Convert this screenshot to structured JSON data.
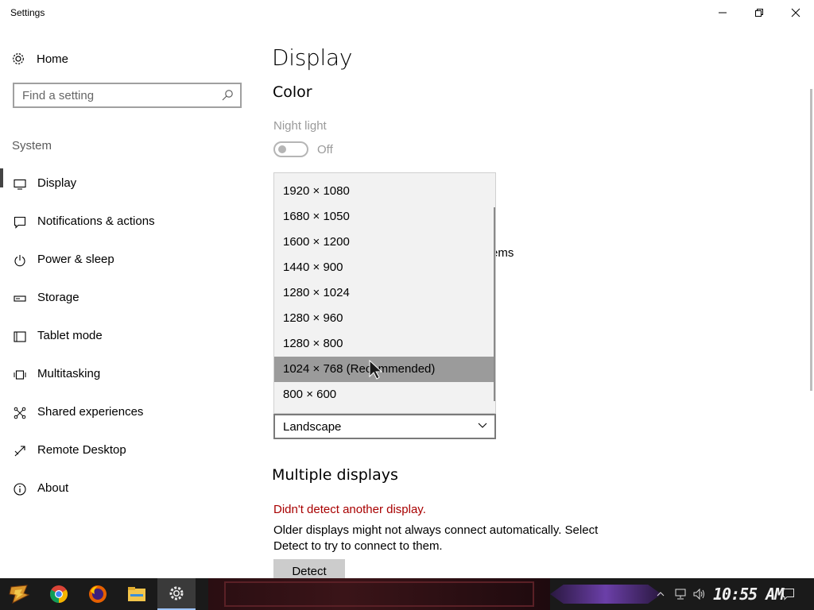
{
  "window": {
    "title": "Settings"
  },
  "sidebar": {
    "home_label": "Home",
    "search_placeholder": "Find a setting",
    "section_label": "System",
    "items": [
      {
        "label": "Display",
        "icon": "monitor-icon"
      },
      {
        "label": "Notifications & actions",
        "icon": "notification-icon"
      },
      {
        "label": "Power & sleep",
        "icon": "power-icon"
      },
      {
        "label": "Storage",
        "icon": "storage-icon"
      },
      {
        "label": "Tablet mode",
        "icon": "tablet-icon"
      },
      {
        "label": "Multitasking",
        "icon": "multitasking-icon"
      },
      {
        "label": "Shared experiences",
        "icon": "shared-icon"
      },
      {
        "label": "Remote Desktop",
        "icon": "remote-desktop-icon"
      },
      {
        "label": "About",
        "icon": "info-icon"
      }
    ],
    "active_index": 0
  },
  "main": {
    "title": "Display",
    "color_heading": "Color",
    "night_light_label": "Night light",
    "night_light_state": "Off",
    "partial_text": "ems",
    "resolution_options": [
      "1920 × 1080",
      "1680 × 1050",
      "1600 × 1200",
      "1440 × 900",
      "1280 × 1024",
      "1280 × 960",
      "1280 × 800",
      "1024 × 768 (Recommended)",
      "800 × 600"
    ],
    "resolution_selected_index": 7,
    "orientation_value": "Landscape",
    "multiple_displays_heading": "Multiple displays",
    "warning": "Didn't detect another display.",
    "description": "Older displays might not always connect automatically. Select Detect to try to connect to them.",
    "detect_label": "Detect"
  },
  "taskbar": {
    "clock": "10:55 AM",
    "apps": [
      "start-icon",
      "chrome-icon",
      "firefox-icon",
      "file-explorer-icon",
      "settings-icon"
    ]
  },
  "colors": {
    "accent_warning": "#a80000",
    "selected_item": "#9b9b9b",
    "taskbar": "#1a1a1a"
  }
}
